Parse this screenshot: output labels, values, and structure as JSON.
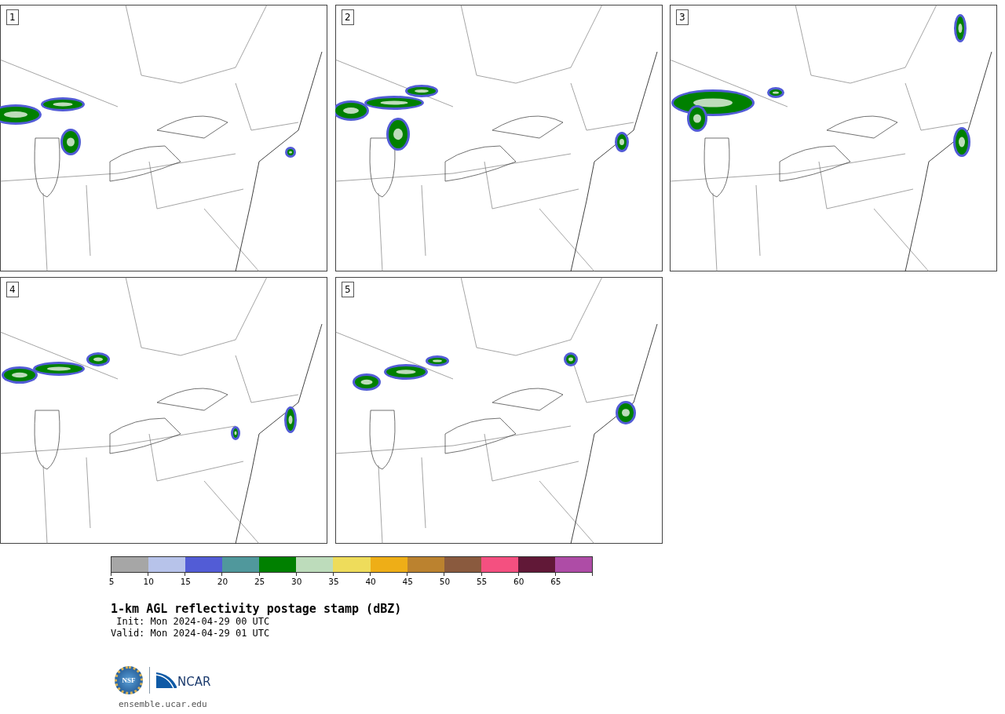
{
  "panels": [
    {
      "label": "1"
    },
    {
      "label": "2"
    },
    {
      "label": "3"
    },
    {
      "label": "4"
    },
    {
      "label": "5"
    }
  ],
  "colorbar": {
    "bins": [
      {
        "label": "5",
        "color": "#a6a6a6"
      },
      {
        "label": "10",
        "color": "#b7c3ea"
      },
      {
        "label": "15",
        "color": "#525cd6"
      },
      {
        "label": "20",
        "color": "#50989c"
      },
      {
        "label": "25",
        "color": "#008000"
      },
      {
        "label": "30",
        "color": "#bddcbb"
      },
      {
        "label": "35",
        "color": "#eedc5b"
      },
      {
        "label": "40",
        "color": "#eeae17"
      },
      {
        "label": "45",
        "color": "#bb822f"
      },
      {
        "label": "50",
        "color": "#8a5a3e"
      },
      {
        "label": "55",
        "color": "#f45080"
      },
      {
        "label": "60",
        "color": "#611837"
      },
      {
        "label": "65",
        "color": "#ae4ca6"
      }
    ]
  },
  "title": "1-km AGL reflectivity postage stamp (dBZ)",
  "init": " Init: Mon 2024-04-29 00 UTC",
  "valid": "Valid: Mon 2024-04-29 01 UTC",
  "logos": {
    "nsf": "NSF",
    "ncar": "NCAR"
  },
  "site": "ensemble.ucar.edu"
}
